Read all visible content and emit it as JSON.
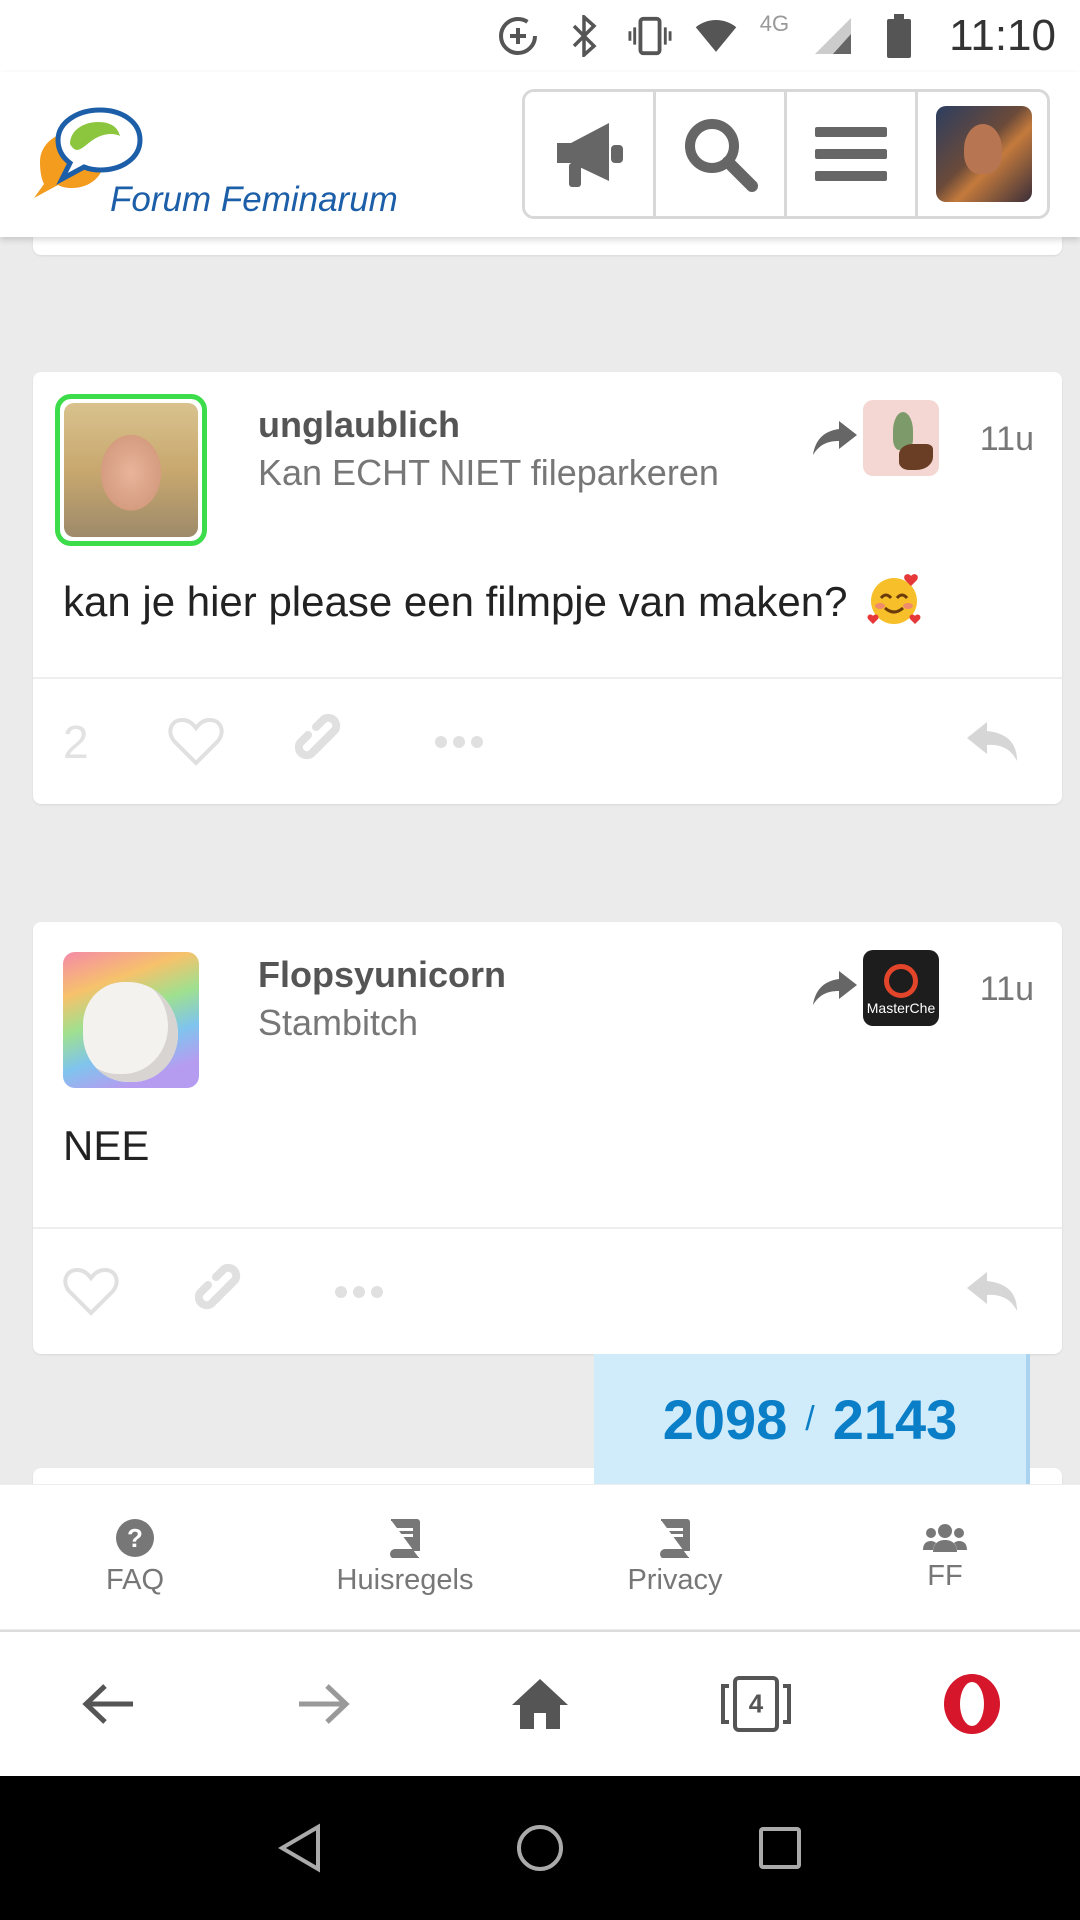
{
  "status_bar": {
    "time": "11:10",
    "network_label": "4G",
    "icons": [
      "data-saver-icon",
      "bluetooth-icon",
      "vibrate-icon",
      "wifi-icon",
      "signal-icon",
      "battery-icon"
    ]
  },
  "header": {
    "logo_text": "Forum Feminarum",
    "buttons": [
      "megaphone-icon",
      "search-icon",
      "menu-icon",
      "user-avatar"
    ]
  },
  "posts": [
    {
      "author": "unglaublich",
      "title": "Kan ECHT NIET fileparkeren",
      "time": "11u",
      "body": "kan je hier please een filmpje van maken?",
      "like_count": "2",
      "avatar_online": true
    },
    {
      "author": "Flopsyunicorn",
      "title": "Stambitch",
      "time": "11u",
      "body": "NEE",
      "reply_to_avatar_text": "MasterChe"
    }
  ],
  "progress": {
    "current": "2098",
    "separator": "/",
    "total": "2143"
  },
  "footer_nav": [
    {
      "label": "FAQ",
      "icon": "question-circle-icon"
    },
    {
      "label": "Huisregels",
      "icon": "book-icon"
    },
    {
      "label": "Privacy",
      "icon": "book-icon"
    },
    {
      "label": "FF",
      "icon": "users-icon"
    }
  ],
  "browser_bar": {
    "tab_count": "4",
    "buttons": [
      "back-arrow-icon",
      "forward-arrow-icon",
      "home-icon",
      "tabs-icon",
      "opera-icon"
    ]
  },
  "colors": {
    "accent_blue": "#0a7ec7",
    "progress_bg": "#d0ebfa",
    "online_ring": "#3ddc4a",
    "opera_red": "#d5162b"
  }
}
